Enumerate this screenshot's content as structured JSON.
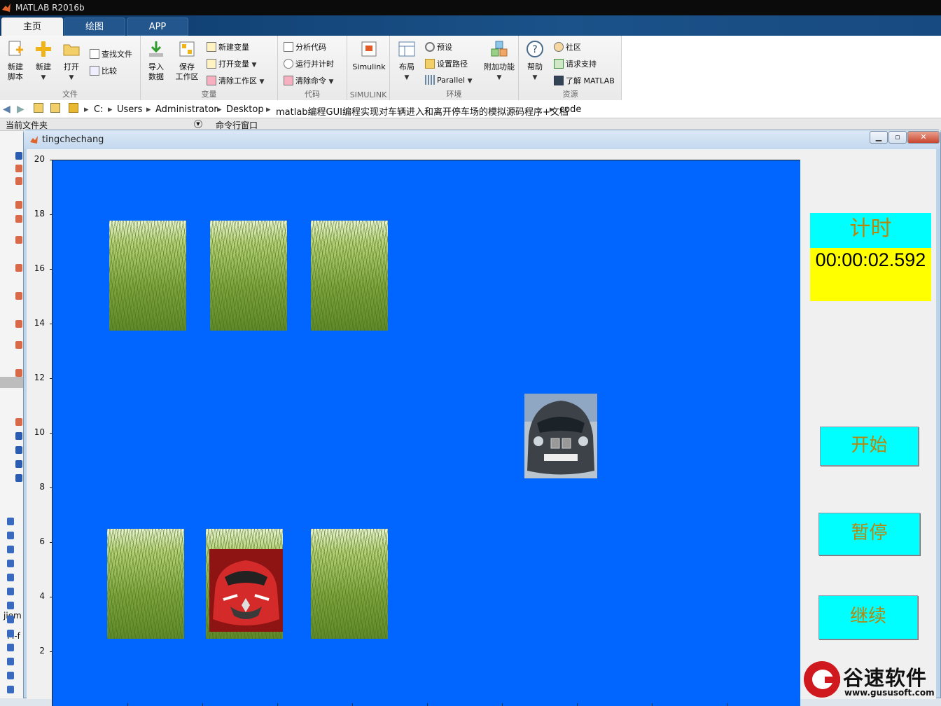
{
  "window": {
    "title": "MATLAB R2016b"
  },
  "tabs": [
    {
      "label": "主页"
    },
    {
      "label": "绘图"
    },
    {
      "label": "APP"
    }
  ],
  "ribbon": {
    "file": {
      "label": "文件",
      "new_script": "新建\n脚本",
      "new": "新建",
      "open": "打开",
      "find_files": "查找文件",
      "compare": "比较"
    },
    "variable": {
      "label": "变量",
      "import": "导入\n数据",
      "save": "保存\n工作区",
      "new_var": "新建变量",
      "open_var": "打开变量",
      "clear_ws": "清除工作区"
    },
    "code": {
      "label": "代码",
      "analyze": "分析代码",
      "run_time": "运行并计时",
      "clear_cmd": "清除命令"
    },
    "simulink": {
      "label": "SIMULINK",
      "simulink": "Simulink"
    },
    "env": {
      "label": "环境",
      "layout": "布局",
      "prefs": "预设",
      "set_path": "设置路径",
      "parallel": "Parallel",
      "addons": "附加功能"
    },
    "resources": {
      "label": "资源",
      "help": "帮助",
      "community": "社区",
      "support": "请求支持",
      "learn": "了解 MATLAB"
    }
  },
  "address": [
    "C:",
    "Users",
    "Administrator",
    "Desktop",
    "matlab编程GUI编程实现对车辆进入和离开停车场的模拟源码程序+文档",
    "code"
  ],
  "panels": {
    "current_folder": "当前文件夹",
    "command_window": "命令行窗口",
    "left_file": "jiem",
    "left_mf": "M-f"
  },
  "figure": {
    "title": "tingchechang"
  },
  "chart_data": {
    "type": "image-plot",
    "ylim": [
      0,
      20
    ],
    "yticks": [
      "20",
      "18",
      "16",
      "14",
      "12",
      "10",
      "8",
      "6",
      "4",
      "2"
    ],
    "background": "#0066ff"
  },
  "timer": {
    "label": "计时",
    "value": "00:00:02.592"
  },
  "buttons": {
    "start": "开始",
    "pause": "暂停",
    "resume": "继续"
  },
  "watermark": {
    "brand": "谷速软件",
    "url": "www.gususoft.com"
  }
}
